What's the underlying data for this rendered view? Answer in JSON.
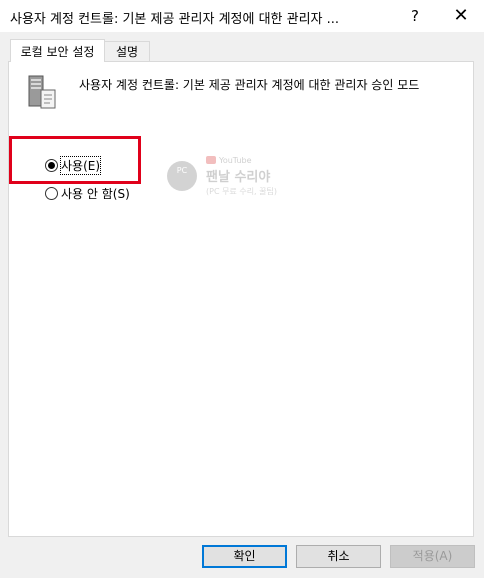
{
  "window": {
    "title": "사용자 계정 컨트롤: 기본 제공 관리자 계정에 대한 관리자 ...",
    "help_label": "?",
    "close_label": "✕"
  },
  "tabs": [
    {
      "label": "로컬 보안 설정",
      "active": true
    },
    {
      "label": "설명",
      "active": false
    }
  ],
  "policy": {
    "icon": "server-policy-icon",
    "text": "사용자 계정 컨트롤: 기본 제공 관리자 계정에 대한 관리자 승인 모드"
  },
  "options": [
    {
      "label": "사용(E)",
      "checked": true
    },
    {
      "label": "사용 안 함(S)",
      "checked": false
    }
  ],
  "watermark": {
    "badge": "PC",
    "channel": "YouTube",
    "name": "팬날 수리야",
    "sub": "(PC 무료 수리, 꿀팁)"
  },
  "buttons": {
    "ok": "확인",
    "cancel": "취소",
    "apply": "적용(A)"
  },
  "colors": {
    "highlight": "#e0001a",
    "default_button_border": "#0078d7"
  }
}
